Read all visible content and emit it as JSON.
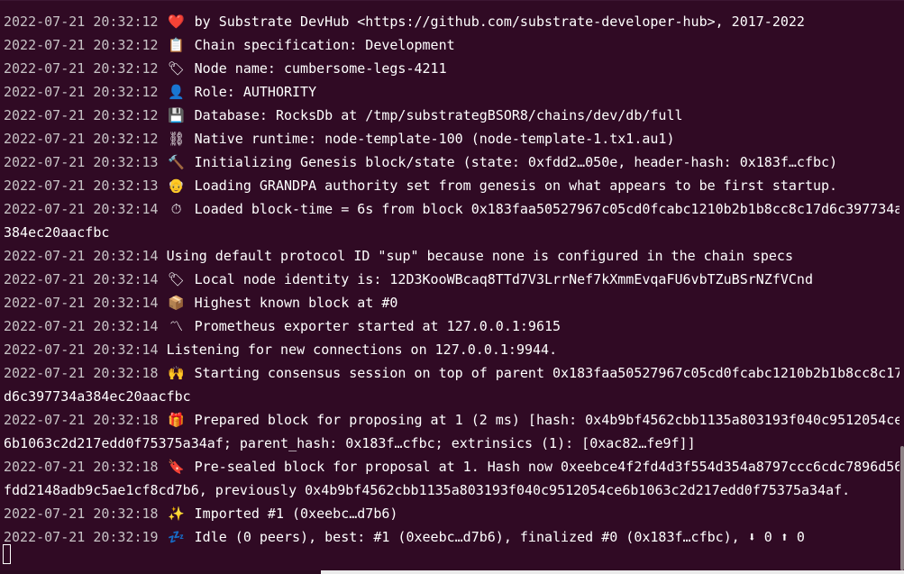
{
  "terminal": {
    "lines": [
      {
        "time": "2022-07-21 20:32:12",
        "icon": "heart-icon",
        "glyph": "❤️",
        "text": "by Substrate DevHub <https://github.com/substrate-developer-hub>, 2017-2022"
      },
      {
        "time": "2022-07-21 20:32:12",
        "icon": "clipboard-icon",
        "glyph": "📋",
        "text": "Chain specification: Development"
      },
      {
        "time": "2022-07-21 20:32:12",
        "icon": "label-icon",
        "glyph": "🏷",
        "text": "Node name: cumbersome-legs-4211"
      },
      {
        "time": "2022-07-21 20:32:12",
        "icon": "person-icon",
        "glyph": "👤",
        "text": "Role: AUTHORITY"
      },
      {
        "time": "2022-07-21 20:32:12",
        "icon": "floppy-disk-icon",
        "glyph": "💾",
        "text": "Database: RocksDb at /tmp/substrategBSOR8/chains/dev/db/full"
      },
      {
        "time": "2022-07-21 20:32:12",
        "icon": "chain-icon",
        "glyph": "⛓",
        "text": "Native runtime: node-template-100 (node-template-1.tx1.au1)"
      },
      {
        "time": "2022-07-21 20:32:13",
        "icon": "hammer-icon",
        "glyph": "🔨",
        "text": "Initializing Genesis block/state (state: 0xfdd2…050e, header-hash: 0x183f…cfbc)"
      },
      {
        "time": "2022-07-21 20:32:13",
        "icon": "elderly-person-icon",
        "glyph": "👴",
        "text": "Loading GRANDPA authority set from genesis on what appears to be first startup."
      },
      {
        "time": "2022-07-21 20:32:14",
        "icon": "stopwatch-icon",
        "glyph": "⏱",
        "text": "Loaded block-time = 6s from block 0x183faa50527967c05cd0fcabc1210b2b1b8cc8c17d6c397734a",
        "cont": "384ec20aacfbc"
      },
      {
        "time": "2022-07-21 20:32:14",
        "icon": "",
        "glyph": "",
        "text": "Using default protocol ID \"sup\" because none is configured in the chain specs"
      },
      {
        "time": "2022-07-21 20:32:14",
        "icon": "label-icon",
        "glyph": "🏷",
        "text": "Local node identity is: 12D3KooWBcaq8TTd7V3LrrNef7kXmmEvqaFU6vbTZuBSrNZfVCnd"
      },
      {
        "time": "2022-07-21 20:32:14",
        "icon": "package-icon",
        "glyph": "📦",
        "text": "Highest known block at #0"
      },
      {
        "time": "2022-07-21 20:32:14",
        "icon": "chart-trend-icon",
        "glyph": "〽",
        "text": "Prometheus exporter started at 127.0.0.1:9615"
      },
      {
        "time": "2022-07-21 20:32:14",
        "icon": "",
        "glyph": "",
        "text": "Listening for new connections on 127.0.0.1:9944."
      },
      {
        "time": "2022-07-21 20:32:18",
        "icon": "raised-hands-icon",
        "glyph": "🙌",
        "text": "Starting consensus session on top of parent 0x183faa50527967c05cd0fcabc1210b2b1b8cc8c17",
        "cont": "d6c397734a384ec20aacfbc"
      },
      {
        "time": "2022-07-21 20:32:18",
        "icon": "gift-icon",
        "glyph": "🎁",
        "text": "Prepared block for proposing at 1 (2 ms) [hash: 0x4b9bf4562cbb1135a803193f040c9512054ce",
        "cont": "6b1063c2d217edd0f75375a34af; parent_hash: 0x183f…cfbc; extrinsics (1): [0xac82…fe9f]]"
      },
      {
        "time": "2022-07-21 20:32:18",
        "icon": "bookmark-icon",
        "glyph": "🔖",
        "text": "Pre-sealed block for proposal at 1. Hash now 0xeebce4f2fd4d3f554d354a8797ccc6cdc7896d56",
        "cont": "fdd2148adb9c5ae1cf8cd7b6, previously 0x4b9bf4562cbb1135a803193f040c9512054ce6b1063c2d217edd0f75375a34af."
      },
      {
        "time": "2022-07-21 20:32:18",
        "icon": "sparkles-icon",
        "glyph": "✨",
        "text": "Imported #1 (0xeebc…d7b6)"
      },
      {
        "time": "2022-07-21 20:32:19",
        "icon": "sleeping-icon",
        "glyph": "💤",
        "text": "Idle (0 peers), best: #1 (0xeebc…d7b6), finalized #0 (0x183f…cfbc), ⬇ 0 ⬆ 0"
      }
    ]
  }
}
